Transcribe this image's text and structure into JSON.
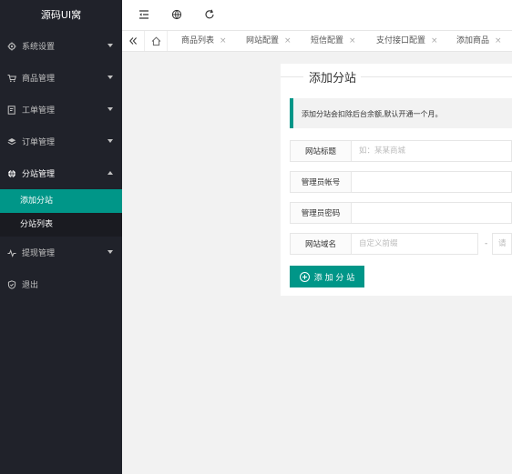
{
  "app": {
    "logo": "源码UI窝"
  },
  "sidebar": {
    "items": [
      {
        "label": "系统设置",
        "icon": "gear-icon"
      },
      {
        "label": "商品管理",
        "icon": "cart-icon"
      },
      {
        "label": "工单管理",
        "icon": "ticket-icon"
      },
      {
        "label": "订单管理",
        "icon": "box-icon"
      },
      {
        "label": "分站管理",
        "icon": "globe-icon"
      },
      {
        "label": "提现管理",
        "icon": "pulse-icon"
      },
      {
        "label": "退出",
        "icon": "shield-icon"
      }
    ],
    "sub": [
      {
        "label": "添加分站"
      },
      {
        "label": "分站列表"
      }
    ]
  },
  "tabs": [
    {
      "label": "商品列表"
    },
    {
      "label": "网站配置"
    },
    {
      "label": "短信配置"
    },
    {
      "label": "支付接口配置"
    },
    {
      "label": "添加商品"
    }
  ],
  "tab_close": "×",
  "form": {
    "title": "添加分站",
    "notice": "添加分站会扣除后台余额,默认开通一个月。",
    "site_title_label": "网站标题",
    "site_title_placeholder": "如：某某商城",
    "admin_account_label": "管理员帐号",
    "admin_password_label": "管理员密码",
    "domain_label": "网站域名",
    "domain_prefix_placeholder": "自定义前缀",
    "domain_sep": "-",
    "domain_suffix_placeholder": "请选择",
    "submit_label": "添 加 分 站"
  },
  "colors": {
    "accent": "#009688",
    "sidebar": "#20222a"
  }
}
